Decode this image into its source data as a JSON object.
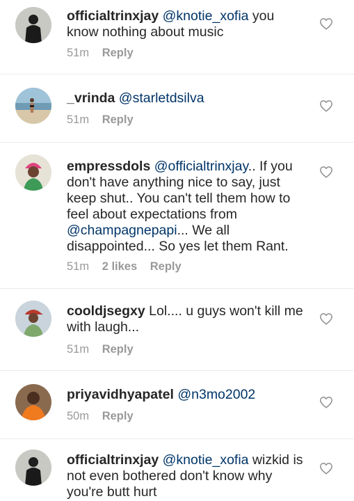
{
  "comments": [
    {
      "username": "officialtrinxjay",
      "mention": "@knotie_xofia",
      "text": " you know nothing about music",
      "time": "51m",
      "likes": "",
      "reply": "Reply",
      "avatar_icon": "dark-figure-avatar"
    },
    {
      "username": "_vrinda",
      "mention": "@starletdsilva",
      "text": "",
      "time": "51m",
      "likes": "",
      "reply": "Reply",
      "avatar_icon": "beach-photo-avatar"
    },
    {
      "username": "empressdols",
      "mention": "@officialtrinxjay",
      "text": ".. If you don't have anything nice to say, just keep shut.. You can't tell them how to feel about expectations from ",
      "mention2": "@champagnepapi",
      "text2": "... We all disappointed... So yes let them Rant.",
      "time": "51m",
      "likes": "2 likes",
      "reply": "Reply",
      "avatar_icon": "pink-hair-avatar"
    },
    {
      "username": "cooldjsegxy",
      "mention": "",
      "text": "Lol.... u guys won't kill me with laugh...",
      "time": "51m",
      "likes": "",
      "reply": "Reply",
      "avatar_icon": "cap-man-avatar"
    },
    {
      "username": "priyavidhyapatel",
      "mention": "@n3mo2002",
      "text": "",
      "time": "50m",
      "likes": "",
      "reply": "Reply",
      "avatar_icon": "orange-shirt-avatar"
    },
    {
      "username": "officialtrinxjay",
      "mention": "@knotie_xofia",
      "text": " wizkid is not even bothered don't know why you're butt hurt",
      "time": "",
      "likes": "",
      "reply": "",
      "avatar_icon": "dark-figure-avatar"
    }
  ],
  "colors": {
    "username": "#262626",
    "mention": "#003569",
    "meta": "#999999",
    "heart": "#8e8e8e"
  }
}
